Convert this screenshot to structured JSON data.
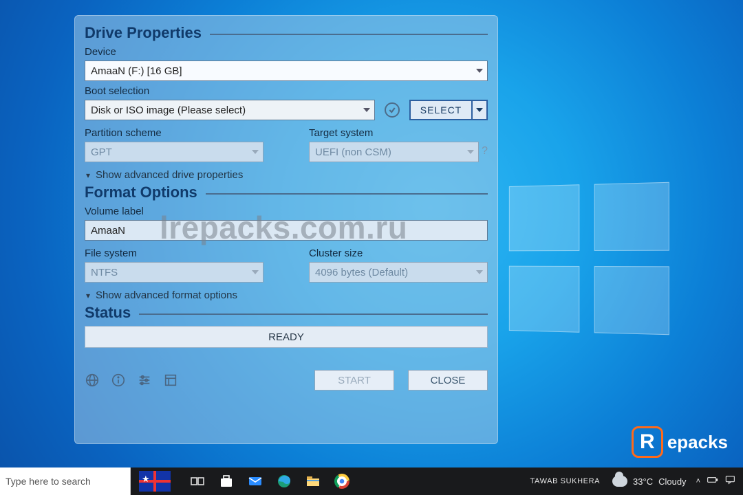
{
  "watermark": "lrepacks.com.ru",
  "brand_text": "epacks",
  "brand_initial": "R",
  "dialog": {
    "section1_title": "Drive Properties",
    "device_label": "Device",
    "device_value": "AmaaN (F:) [16 GB]",
    "boot_label": "Boot selection",
    "boot_value": "Disk or ISO image (Please select)",
    "select_btn": "SELECT",
    "partition_label": "Partition scheme",
    "partition_value": "GPT",
    "target_label": "Target system",
    "target_value": "UEFI (non CSM)",
    "advanced_drive": "Show advanced drive properties",
    "section2_title": "Format Options",
    "volume_label": "Volume label",
    "volume_value": "AmaaN",
    "filesystem_label": "File system",
    "filesystem_value": "NTFS",
    "cluster_label": "Cluster size",
    "cluster_value": "4096 bytes (Default)",
    "advanced_format": "Show advanced format options",
    "section3_title": "Status",
    "status_value": "READY",
    "start_btn": "START",
    "close_btn": "CLOSE"
  },
  "taskbar": {
    "search_placeholder": "Type here to search",
    "user": "TAWAB SUKHERA",
    "weather_temp": "33°C",
    "weather_cond": "Cloudy"
  }
}
